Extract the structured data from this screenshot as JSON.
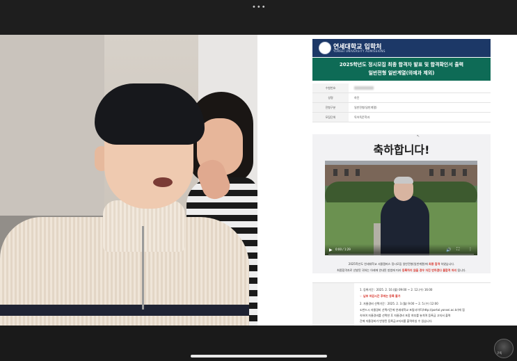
{
  "top_dots": "•••",
  "bottom_avatar_label": "구독",
  "doc": {
    "header": {
      "title": "연세대학교 입학처",
      "subtitle": "YONSEI UNIVERSITY ADMISSIONS"
    },
    "banner": {
      "line1": "2025학년도 정시모집 최종 합격자 발표 및 합격확인서 출력",
      "line2": "일반전형 일반계열(의예과 제외)"
    },
    "info_rows": [
      {
        "key": "수험번호",
        "value": ""
      },
      {
        "key": "성명",
        "value": "하진"
      },
      {
        "key": "전형구분",
        "value": "일반전형(일반계열)"
      },
      {
        "key": "모집단위",
        "value": "독어독문학과"
      }
    ],
    "congrats": "축하합니다!",
    "video": {
      "play": "▶",
      "time": "0:00 / 1:29",
      "volume": "🔊",
      "fullscreen": "⛶",
      "more": "⋮"
    },
    "message": {
      "line1_pre": "2025학년도 연세대학교 서울캠퍼스 정시모집 일반전형(일반계열)에",
      "line1_red": "최종 합격",
      "line1_post": "하였습니다.",
      "line2_pre": "최종합격자로 선발된 귀하는 아래에 안내된 방법에 따라",
      "line2_red": "등록하지 않을 경우 자진 반하겠다 불합격 처리",
      "line2_post": "됩니다."
    },
    "details": [
      {
        "text": "1. 등록기간 : 2025. 2. 10.(월) 09:00 ~ 2. 12.(수) 16:00",
        "red": false
      },
      {
        "text": "☞ 납부 마감시간 후에는 등록 불가",
        "red": true
      },
      {
        "text": "2. 자율경비 선택기간 : 2025. 2. 3.(월) 9:00 ~ 2. 5.(수) 12:00",
        "red": false
      },
      {
        "text": "①반드시 자율경비 선택기간에 연세대학교 포털사이트(http://portal.yonsei.ac.kr)에 접",
        "red": false
      },
      {
        "text": "속하여 자율경비를 선택한 후 자율경비 포함 여부를 놓치며 등록금 고지서 출력",
        "red": false
      },
      {
        "text": "간에 자율경비가 반영된 등록금고지서를 출력하실 수 있습니다.",
        "red": false
      }
    ]
  }
}
